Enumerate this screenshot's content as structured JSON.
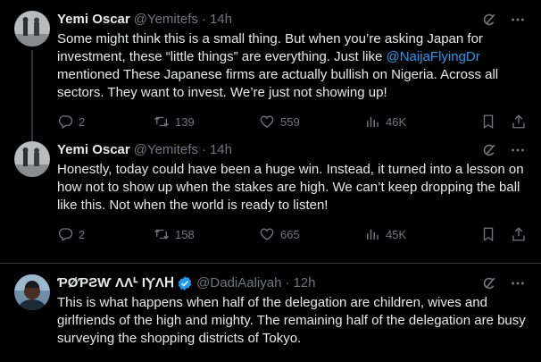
{
  "tweets": [
    {
      "name": "Yemi Oscar",
      "handle": "@Yemitefs",
      "time": "14h",
      "text_before": "Some might think this is a small thing. But when you’re asking Japan for investment, these “little things” are everything. Just like ",
      "mention": "@NaijaFlyingDr",
      "text_after": " mentioned These Japanese firms are actually bullish on Nigeria. Across all sectors. They want to invest. We’re just not showing up!",
      "replies": "2",
      "reposts": "139",
      "likes": "559",
      "views": "46K",
      "icons": {
        "reply": "reply-icon",
        "repost": "repost-icon",
        "like": "heart-icon",
        "views": "views-icon",
        "bookmark": "bookmark-icon",
        "share": "share-icon"
      }
    },
    {
      "name": "Yemi Oscar",
      "handle": "@Yemitefs",
      "time": "14h",
      "text": "Honestly, today could have been a huge win. Instead, it turned into a lesson on how not to show up when the stakes are high. We can’t keep dropping the ball like this. Not when the world is ready to listen!",
      "replies": "2",
      "reposts": "158",
      "likes": "665",
      "views": "45K"
    },
    {
      "name": "ƤØƤƧⱲ ΛΛᒻ ƖⲨΛᕼ",
      "handle": "@DadiAaliyah",
      "time": "12h",
      "verified": true,
      "text": "This is what happens when half of the delegation are children, wives and girlfriends of the high and mighty. The remaining half of the delegation are busy surveying the shopping districts of Tokyo."
    }
  ],
  "colors": {
    "background": "#000000",
    "text": "#e7e9ea",
    "muted": "#71767b",
    "accent": "#1d9bf0",
    "divider": "#2f3336"
  }
}
